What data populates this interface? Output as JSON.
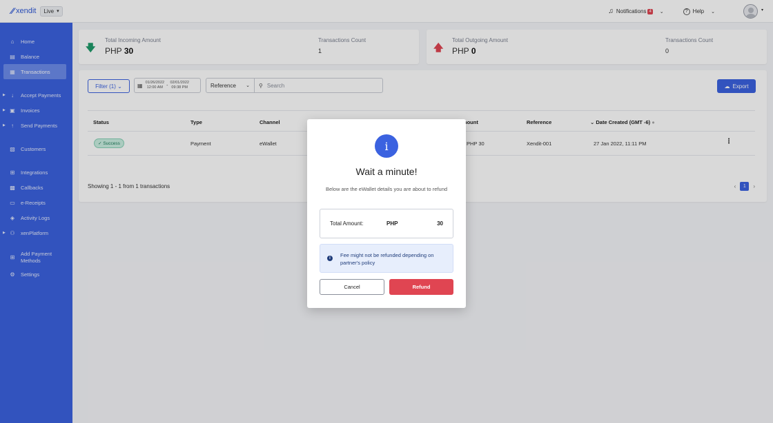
{
  "topbar": {
    "logo_text": "xendit",
    "env": "Live",
    "notifications_label": "Notifications",
    "notifications_count": "4",
    "help_label": "Help"
  },
  "sidebar": {
    "items": [
      {
        "label": "Home",
        "icon": "home-icon"
      },
      {
        "label": "Balance",
        "icon": "balance-icon"
      },
      {
        "label": "Transactions",
        "icon": "transactions-icon"
      },
      {
        "label": "Accept Payments",
        "icon": "accept-payments-icon"
      },
      {
        "label": "Invoices",
        "icon": "invoices-icon"
      },
      {
        "label": "Send Payments",
        "icon": "send-payments-icon"
      },
      {
        "label": "Customers",
        "icon": "customers-icon"
      },
      {
        "label": "Integrations",
        "icon": "integrations-icon"
      },
      {
        "label": "Callbacks",
        "icon": "callbacks-icon"
      },
      {
        "label": "e-Receipts",
        "icon": "receipt-icon"
      },
      {
        "label": "Activity Logs",
        "icon": "activity-logs-icon"
      },
      {
        "label": "xenPlatform",
        "icon": "platform-icon"
      },
      {
        "label": "Add Payment Methods",
        "icon": "add-payment-icon"
      },
      {
        "label": "Settings",
        "icon": "settings-icon"
      }
    ],
    "active": "Transactions"
  },
  "incoming": {
    "label": "Total Incoming Amount",
    "currency": "PHP",
    "amount": "30",
    "count_label": "Transactions Count",
    "count": "1"
  },
  "outgoing": {
    "label": "Total Outgoing Amount",
    "currency": "PHP",
    "amount": "0",
    "count_label": "Transactions Count",
    "count": "0"
  },
  "toolbar": {
    "filter_label": "Filter (1)",
    "date_from": "01/26/2022",
    "time_from": "12:00 AM",
    "date_to": "02/01/2022",
    "time_to": "09:38 PM",
    "reference_select": "Reference",
    "search_placeholder": "Search",
    "export_label": "Export"
  },
  "table": {
    "headers": [
      "Status",
      "Type",
      "Channel",
      "nount",
      "Reference",
      "Date Created (GMT -6)"
    ],
    "rows": [
      {
        "status": "Success",
        "type": "Payment",
        "channel": "eWallet",
        "amount": "PHP 30",
        "reference": "Xendit-001",
        "date": "27 Jan 2022, 11:11 PM"
      }
    ],
    "showing": "Showing 1 - 1 from 1 transactions",
    "page": "1"
  },
  "modal": {
    "icon": "i",
    "title": "Wait a minute!",
    "description": "Below are the eWallet details you are about to refund",
    "total_label": "Total Amount:",
    "total_currency": "PHP",
    "total_value": "30",
    "fee_note": "Fee might not be refunded depending on partner's policy",
    "cancel_label": "Cancel",
    "refund_label": "Refund"
  },
  "colors": {
    "primary": "#3b62e0",
    "danger": "#e04552",
    "success": "#1f7b5b"
  }
}
